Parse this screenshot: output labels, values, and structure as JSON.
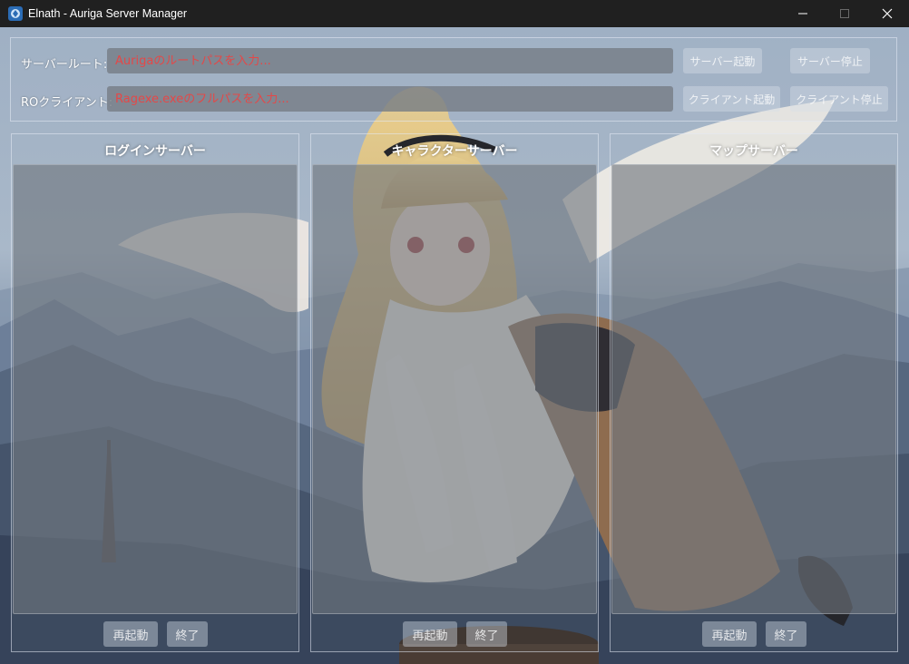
{
  "window": {
    "title": "Elnath - Auriga Server Manager",
    "icons": {
      "app": "app-logo-icon",
      "minimize": "minimize-icon",
      "maximize": "maximize-icon",
      "close": "close-icon"
    }
  },
  "config": {
    "server_root_label": "サーバールート:",
    "server_root_placeholder": "Aurigaのルートパスを入力...",
    "ro_client_label": "ROクライアント:",
    "ro_client_placeholder": "Ragexe.exeのフルパスを入力...",
    "start_server_label": "サーバー起動",
    "stop_server_label": "サーバー停止",
    "start_client_label": "クライアント起動",
    "stop_client_label": "クライアント停止"
  },
  "servers": [
    {
      "title": "ログインサーバー",
      "log": "",
      "restart_label": "再起動",
      "stop_label": "終了"
    },
    {
      "title": "キャラクターサーバー",
      "log": "",
      "restart_label": "再起動",
      "stop_label": "終了"
    },
    {
      "title": "マップサーバー",
      "log": "",
      "restart_label": "再起動",
      "stop_label": "終了"
    }
  ],
  "colors": {
    "placeholder_text": "#e44848",
    "titlebar_bg": "#202020",
    "panel_border": "#e6ebf5"
  }
}
